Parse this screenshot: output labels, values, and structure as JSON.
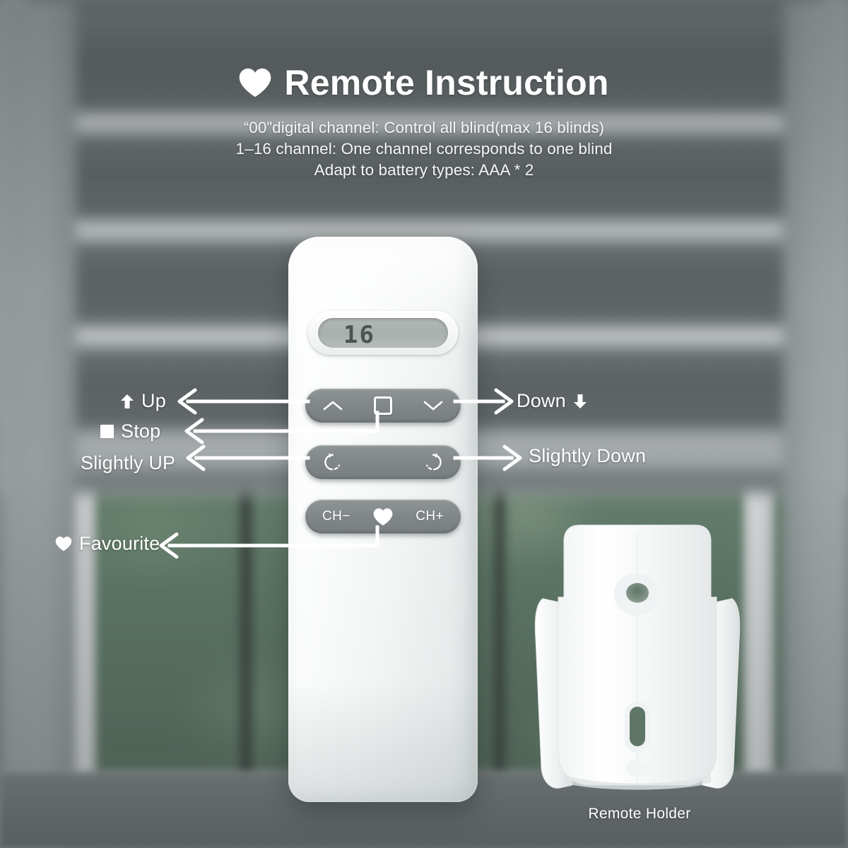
{
  "header": {
    "heart_icon": "heart-icon",
    "title": "Remote Instruction",
    "lines": [
      "“00”digital channel: Control all blind(max 16 blinds)",
      "1–16 channel: One channel corresponds to one blind",
      "Adapt to battery types: AAA * 2"
    ]
  },
  "remote": {
    "display_value": "16",
    "rows": [
      {
        "name": "up-stop-down-row",
        "left_icon": "chevron-up-icon",
        "center_icon": "square-stop-icon",
        "right_icon": "chevron-down-icon"
      },
      {
        "name": "tilt-row",
        "left_icon": "rotate-counterclockwise-icon",
        "right_icon": "rotate-clockwise-icon"
      },
      {
        "name": "channel-row",
        "left_label": "CH−",
        "center_icon": "heart-icon",
        "right_label": "CH+"
      }
    ]
  },
  "callouts": {
    "up": {
      "label": "Up",
      "icon": "arrow-up-icon"
    },
    "stop": {
      "label": "Stop",
      "icon": "square-icon"
    },
    "slightly_up": {
      "label": "Slightly UP"
    },
    "favourite": {
      "label": "Favourite",
      "icon": "heart-icon"
    },
    "down": {
      "label": "Down",
      "icon": "arrow-down-icon"
    },
    "slightly_down": {
      "label": "Slightly Down"
    }
  },
  "holder": {
    "caption": "Remote Holder"
  },
  "colors": {
    "text": "#ffffff",
    "button_gray": "#82888a",
    "remote_white": "#f7f9f9",
    "lcd_gray": "#aeb4b2",
    "foliage_green": "#5f7a68",
    "blind_slat": "#62686a"
  }
}
